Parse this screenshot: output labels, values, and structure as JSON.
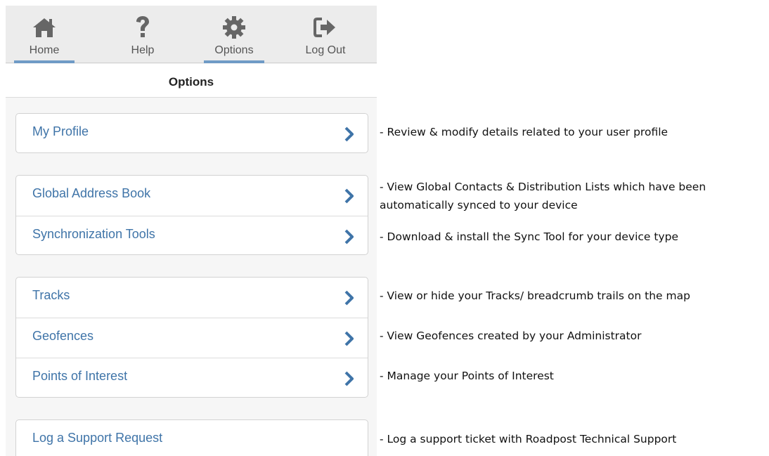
{
  "tabs": [
    {
      "label": "Home",
      "icon": "home-icon",
      "underline": true
    },
    {
      "label": "Help",
      "icon": "question-icon",
      "underline": false
    },
    {
      "label": "Options",
      "icon": "gear-icon",
      "underline": true
    },
    {
      "label": "Log Out",
      "icon": "sign-out-icon",
      "underline": false
    }
  ],
  "header": {
    "title": "Options"
  },
  "menu": {
    "my_profile": "My Profile",
    "global_address_book": "Global Address Book",
    "sync_tools": "Synchronization Tools",
    "tracks": "Tracks",
    "geofences": "Geofences",
    "points_of_interest": "Points of Interest",
    "support_request": "Log a Support Request"
  },
  "descriptions": {
    "my_profile": "- Review & modify details related to your user profile",
    "global_address_book_line1": "- View Global Contacts & Distribution Lists which have been",
    "global_address_book_line2": "automatically synced to your device",
    "sync_tools": "- Download & install the Sync Tool for your device type",
    "tracks": "- View or hide your Tracks/ breadcrumb trails on the map",
    "geofences": "- View Geofences created by your Administrator",
    "points_of_interest": "- Manage your Points of Interest",
    "support_request": "- Log a support ticket with Roadpost Technical Support"
  },
  "colors": {
    "link": "#3f74a8",
    "tab_underline": "#6f9bc6",
    "icon": "#666666"
  }
}
